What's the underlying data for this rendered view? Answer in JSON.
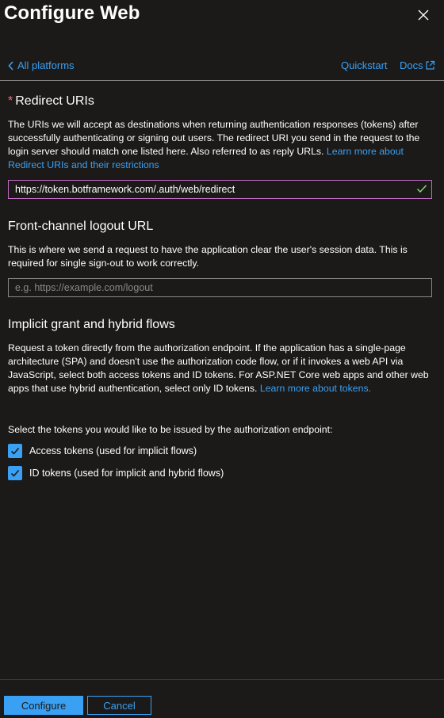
{
  "panel": {
    "title": "Configure Web",
    "close_icon": "close-icon"
  },
  "nav": {
    "back_label": "All platforms",
    "quickstart_label": "Quickstart",
    "docs_label": "Docs"
  },
  "redirect": {
    "required_marker": "*",
    "heading": "Redirect URIs",
    "description": "The URIs we will accept as destinations when returning authentication responses (tokens) after successfully authenticating or signing out users. The redirect URI you send in the request to the login server should match one listed here. Also referred to as reply URLs.",
    "learn_more": "Learn more about Redirect URIs and their restrictions",
    "uri_value": "https://token.botframework.com/.auth/web/redirect",
    "valid_icon": "checkmark-icon"
  },
  "logout": {
    "heading": "Front-channel logout URL",
    "description": "This is where we send a request to have the application clear the user's session data. This is required for single sign-out to work correctly.",
    "placeholder": "e.g. https://example.com/logout",
    "value": ""
  },
  "implicit": {
    "heading": "Implicit grant and hybrid flows",
    "description": "Request a token directly from the authorization endpoint. If the application has a single-page architecture (SPA) and doesn't use the authorization code flow, or if it invokes a web API via JavaScript, select both access tokens and ID tokens. For ASP.NET Core web apps and other web apps that use hybrid authentication, select only ID tokens.",
    "learn_more": "Learn more about tokens.",
    "select_prompt": "Select the tokens you would like to be issued by the authorization endpoint:",
    "options": [
      {
        "label": "Access tokens (used for implicit flows)",
        "checked": true
      },
      {
        "label": "ID tokens (used for implicit and hybrid flows)",
        "checked": true
      }
    ]
  },
  "footer": {
    "configure_label": "Configure",
    "cancel_label": "Cancel"
  },
  "colors": {
    "background": "#1b1a19",
    "accent": "#3aa0f3",
    "required": "#f1707b",
    "focus_border": "#c36dc6",
    "valid": "#8dd16d"
  }
}
